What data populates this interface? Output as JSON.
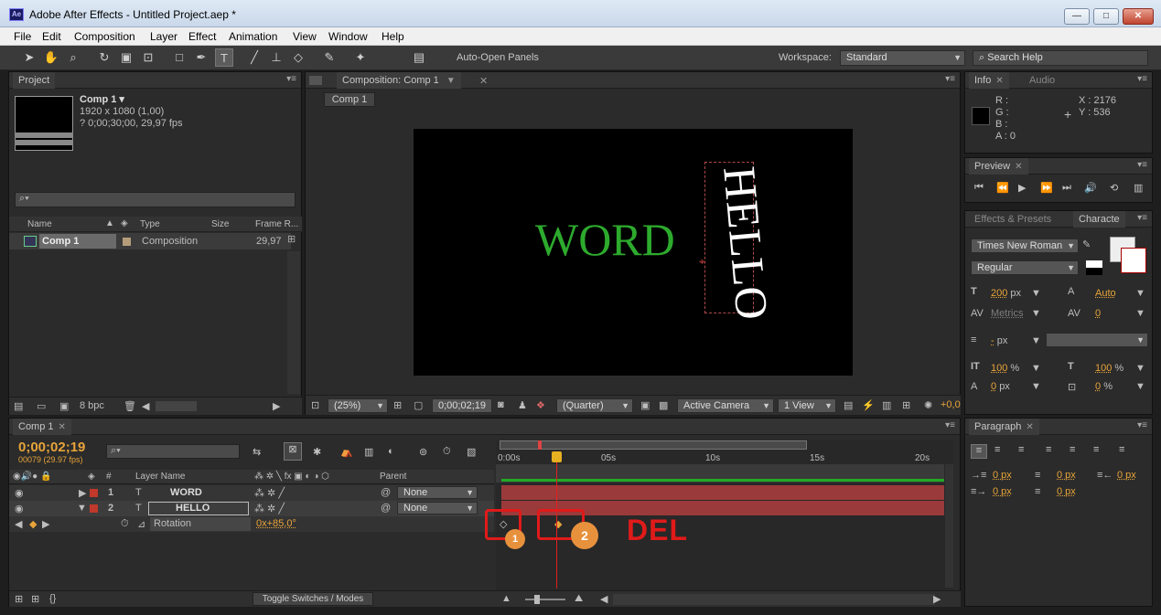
{
  "window": {
    "title": "Adobe After Effects - Untitled Project.aep *",
    "app_icon": "Ae",
    "min": "—",
    "max": "□",
    "close": "✕"
  },
  "menu": [
    "File",
    "Edit",
    "Composition",
    "Layer",
    "Effect",
    "Animation",
    "View",
    "Window",
    "Help"
  ],
  "toolbar": {
    "auto_open_label": "Auto-Open Panels",
    "workspace_label": "Workspace:",
    "workspace_value": "Standard",
    "search_help": "Search Help"
  },
  "project": {
    "tab": "Project",
    "comp_name": "Comp 1 ▾",
    "comp_size": "1920 x 1080 (1,00)",
    "comp_duration": "? 0;00;30;00, 29,97 fps",
    "columns": [
      "Name",
      "Type",
      "Size",
      "Frame R..."
    ],
    "items": [
      {
        "name": "Comp 1",
        "type": "Composition",
        "fps": "29,97"
      }
    ],
    "bpc": "8 bpc"
  },
  "composition": {
    "tab": "Composition: Comp 1",
    "sub_tab": "Comp 1",
    "text_word": "WORD",
    "text_hello": "HELLO",
    "zoom": "(25%)",
    "timecode": "0;00;02;19",
    "resolution": "(Quarter)",
    "camera": "Active Camera",
    "views": "1 View",
    "offset": "+0,0"
  },
  "info": {
    "tab": "Info",
    "tab2": "Audio",
    "r": "R :",
    "g": "G :",
    "b": "B :",
    "a": "A : 0",
    "x": "X : 2176",
    "y": "Y : 536"
  },
  "preview": {
    "tab": "Preview"
  },
  "effects": {
    "tab": "Effects & Presets"
  },
  "character": {
    "tab": "Characte",
    "font": "Times New Roman",
    "style": "Regular",
    "font_size": "200",
    "size_unit": "px",
    "leading": "Auto",
    "kerning": "Metrics",
    "tracking": "0",
    "stroke": "-",
    "stroke_unit": "px",
    "vscale": "100",
    "hscale": "100",
    "pct": "%",
    "baseline": "0",
    "baseline_unit": "px",
    "tsume": "0",
    "tsume_unit": "%"
  },
  "timeline": {
    "tab": "Comp 1",
    "timecode": "0;00;02;19",
    "frame_info": "00079 (29.97 fps)",
    "col_layer_name": "Layer Name",
    "col_parent": "Parent",
    "layers": [
      {
        "num": "1",
        "name": "WORD",
        "parent": "None",
        "color": "#c0392b"
      },
      {
        "num": "2",
        "name": "HELLO",
        "parent": "None",
        "color": "#c0392b"
      }
    ],
    "property": {
      "name": "Rotation",
      "value": "0x+85,0°"
    },
    "ruler": [
      "0:00s",
      "05s",
      "10s",
      "15s",
      "20s"
    ],
    "toggle": "Toggle Switches / Modes",
    "annotation_del": "DEL",
    "badge1": "1",
    "badge2": "2"
  },
  "paragraph": {
    "tab": "Paragraph",
    "v1": "0 px",
    "v2": "0 px",
    "v3": "0 px",
    "v4": "0 px",
    "v5": "0 px"
  }
}
